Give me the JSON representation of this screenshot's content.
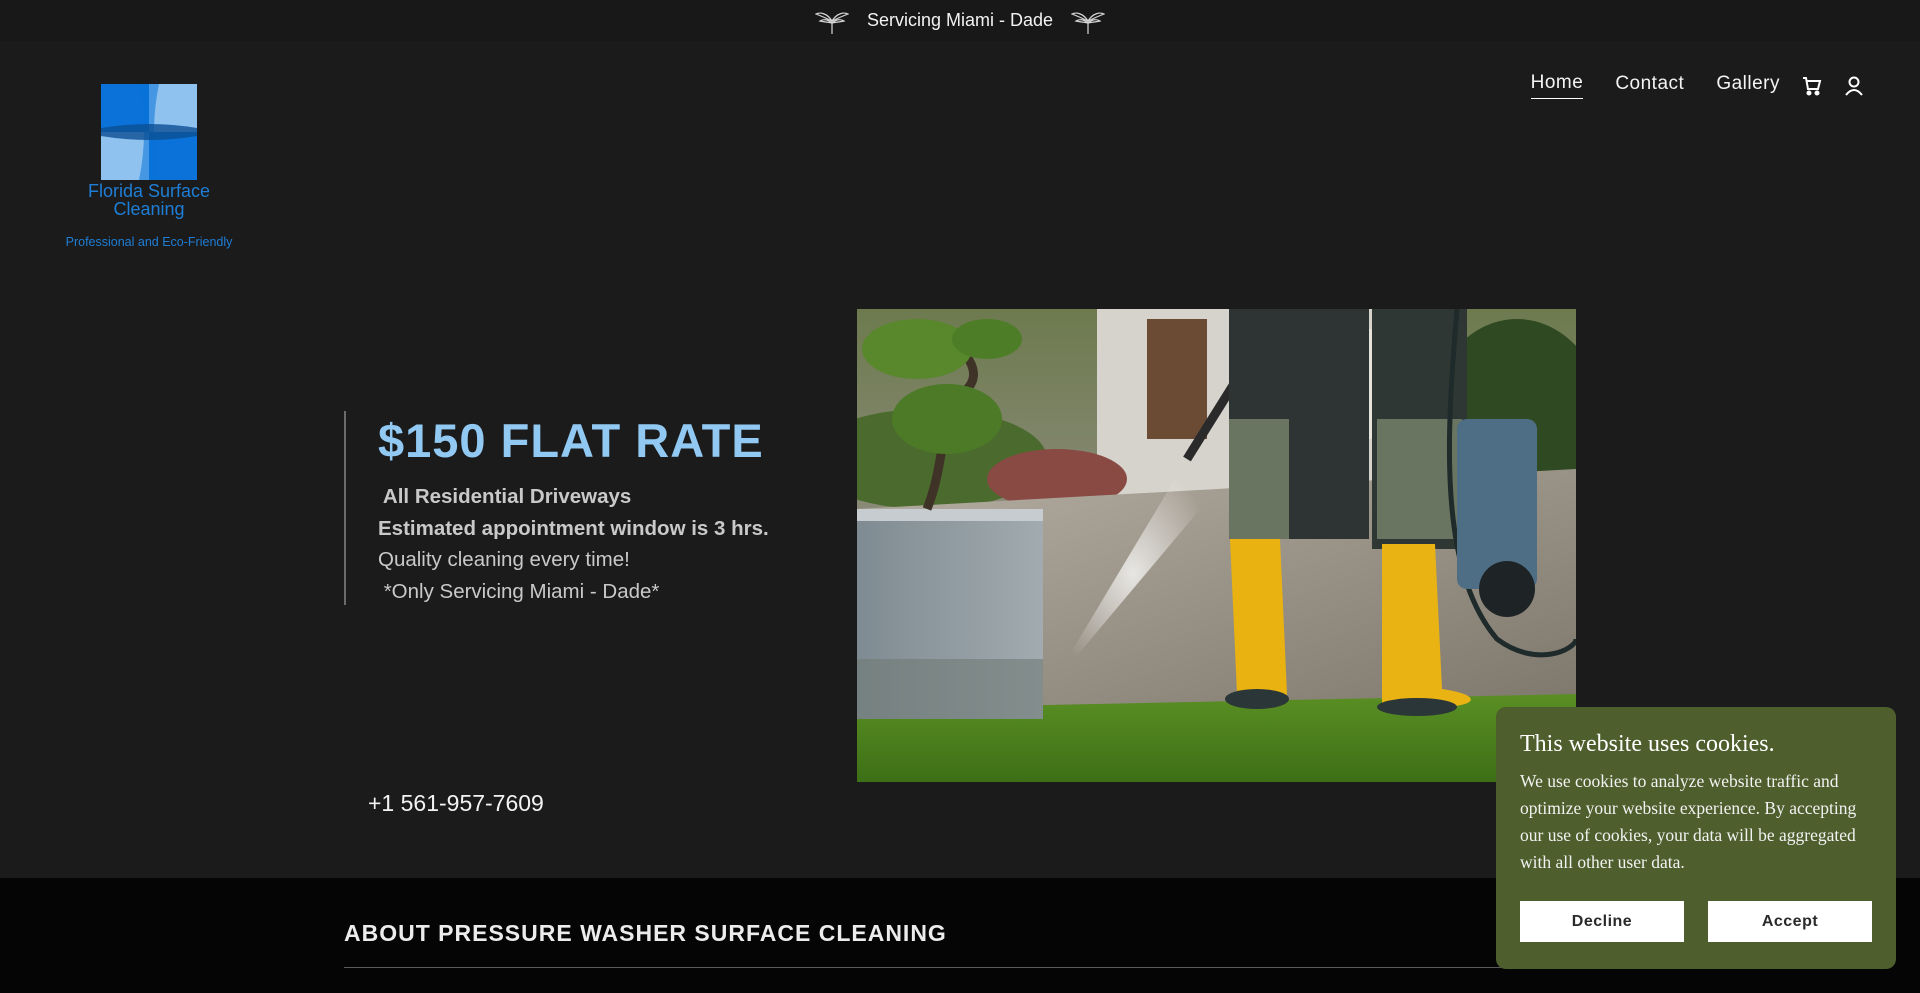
{
  "announcement": {
    "text": "Servicing Miami - Dade",
    "left_icon": "flower-icon",
    "right_icon": "flower-icon"
  },
  "logo": {
    "name": "Florida Surface Cleaning",
    "tagline": "Professional and Eco-Friendly",
    "colors": {
      "dark": "#0a72d8",
      "light": "#8fc2ef"
    }
  },
  "nav": {
    "links": [
      {
        "label": "Home",
        "active": true
      },
      {
        "label": "Contact",
        "active": false
      },
      {
        "label": "Gallery",
        "active": false
      }
    ],
    "cart_icon": "cart-icon",
    "account_icon": "account-icon"
  },
  "hero": {
    "title": "$150 FLAT RATE",
    "lines": [
      {
        "text": " All Residential Driveways",
        "bold": true
      },
      {
        "text": "Estimated appointment window is 3 hrs.",
        "bold": true
      },
      {
        "text": "Quality cleaning every time!",
        "bold": false
      },
      {
        "text": " *Only Servicing Miami - Dade*",
        "bold": false
      }
    ],
    "phone": "+1 561-957-7609",
    "accent_color": "#91c9f3"
  },
  "about": {
    "heading": "ABOUT PRESSURE WASHER SURFACE CLEANING"
  },
  "cookie_banner": {
    "title": "This website uses cookies.",
    "body": "We use cookies to analyze website traffic and optimize your website experience. By accepting our use of cookies, your data will be aggregated with all other user data.",
    "decline_label": "Decline",
    "accept_label": "Accept",
    "background": "#4e5e2d"
  }
}
